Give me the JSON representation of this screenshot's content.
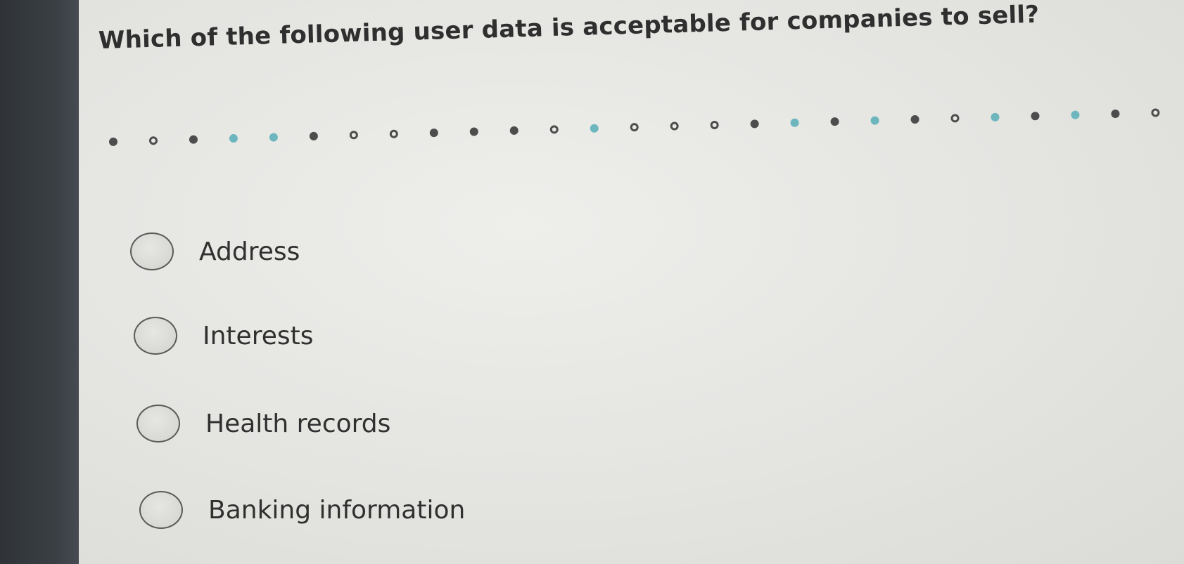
{
  "question": {
    "text": "Which of the following user data is acceptable for companies to sell?"
  },
  "progress": {
    "dots": [
      "filled",
      "open",
      "filled",
      "accent",
      "accent",
      "filled",
      "open",
      "open",
      "filled",
      "filled",
      "filled",
      "open",
      "accent",
      "open",
      "open",
      "open",
      "filled",
      "accent",
      "filled",
      "accent",
      "filled",
      "open",
      "accent",
      "filled",
      "accent",
      "filled",
      "open"
    ]
  },
  "options": [
    {
      "label": "Address",
      "selected": false
    },
    {
      "label": "Interests",
      "selected": false
    },
    {
      "label": "Health records",
      "selected": false
    },
    {
      "label": "Banking information",
      "selected": false
    }
  ],
  "colors": {
    "accent": "#6eb6be",
    "dark_dot": "#4d4d4d",
    "bezel": "#3a3f44"
  }
}
